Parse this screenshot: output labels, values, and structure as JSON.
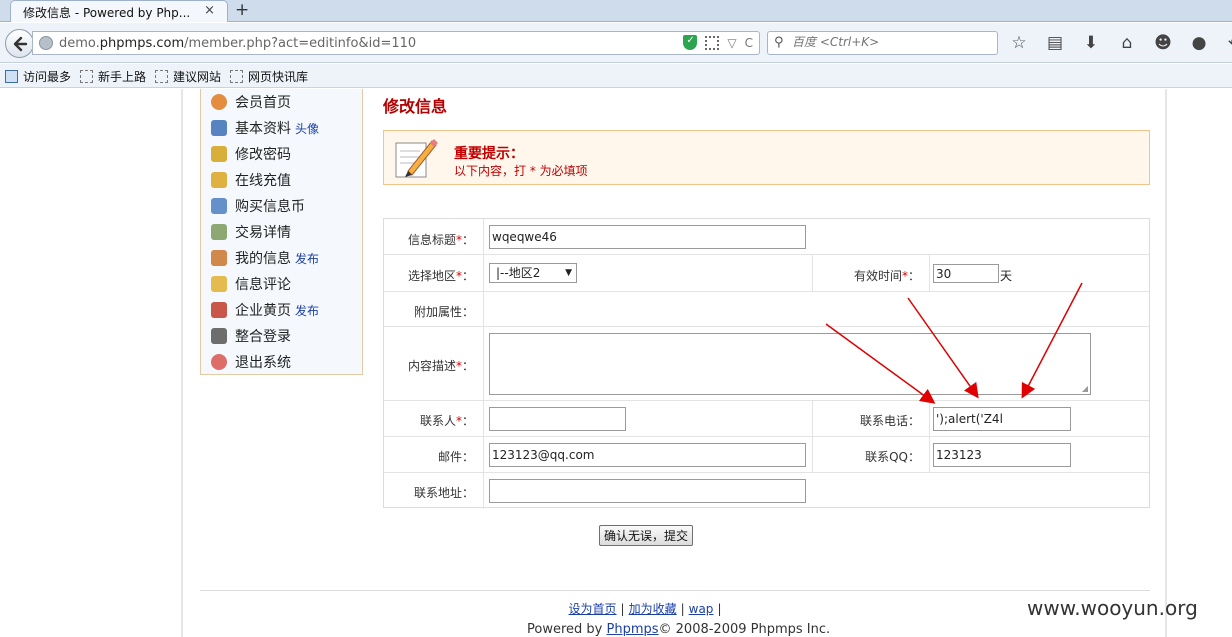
{
  "browser": {
    "tab_title": "修改信息 - Powered by Php...",
    "tab_close": "×",
    "new_tab": "+",
    "url_prefix": "demo.",
    "url_domain": "phpmps.com",
    "url_path": "/member.php?act=editinfo&id=110",
    "url_dropdown": "▽",
    "reload": "C",
    "search_placeholder": "百度 <Ctrl+K>",
    "bookmarks": [
      "访问最多",
      "新手上路",
      "建议网站",
      "网页快讯库"
    ]
  },
  "menu": {
    "items": [
      {
        "label": "会员首页",
        "sub": "",
        "icon": "home-icon",
        "color": "#e07a1f"
      },
      {
        "label": "基本资料",
        "sub": "头像",
        "icon": "user-icon",
        "color": "#3b6fb6"
      },
      {
        "label": "修改密码",
        "sub": "",
        "icon": "key-icon",
        "color": "#d4a21a"
      },
      {
        "label": "在线充值",
        "sub": "",
        "icon": "coins-icon",
        "color": "#d9a520"
      },
      {
        "label": "购买信息币",
        "sub": "",
        "icon": "monitor-icon",
        "color": "#4a7fc1"
      },
      {
        "label": "交易详情",
        "sub": "",
        "icon": "list-icon",
        "color": "#7a9a5a"
      },
      {
        "label": "我的信息",
        "sub": "发布",
        "icon": "edit-icon",
        "color": "#c9742c"
      },
      {
        "label": "信息评论",
        "sub": "",
        "icon": "folder-icon",
        "color": "#e0b030"
      },
      {
        "label": "企业黄页",
        "sub": "发布",
        "icon": "person-icon",
        "color": "#c0392b"
      },
      {
        "label": "整合登录",
        "sub": "",
        "icon": "login-icon",
        "color": "#555555"
      },
      {
        "label": "退出系统",
        "sub": "",
        "icon": "exit-icon",
        "color": "#d9534f"
      }
    ]
  },
  "page": {
    "title": "修改信息",
    "notice_title": "重要提示：",
    "notice_text": "以下内容，打 * 为必填项"
  },
  "form": {
    "req_mark": "*",
    "title_label": "信息标题",
    "title_value": "wqeqwe46",
    "area_label": "选择地区",
    "area_value": "|--地区2",
    "valid_label": "有效时间",
    "valid_value": "30",
    "valid_unit": "天",
    "attr_label": "附加属性：",
    "desc_label": "内容描述",
    "contact_label": "联系人",
    "contact_value": "",
    "phone_label": "联系电话：",
    "phone_value": "');alert('Z4l",
    "email_label": "邮件：",
    "email_value": "123123@qq.com",
    "qq_label": "联系QQ：",
    "qq_value": "123123",
    "addr_label": "联系地址：",
    "addr_value": "",
    "colon": "：",
    "submit_label": "确认无误，提交"
  },
  "footer": {
    "links": [
      "设为首页",
      "加为收藏",
      "wap"
    ],
    "sep": "|",
    "powered_prefix": "Powered by ",
    "powered_link": "Phpmps",
    "copyright": "© 2008-2009 Phpmps Inc."
  },
  "watermark": "www.wooyun.org",
  "colors": {
    "accent_red": "#b30000",
    "link_blue": "#1a3fa8",
    "arrow_red": "#e00000"
  }
}
